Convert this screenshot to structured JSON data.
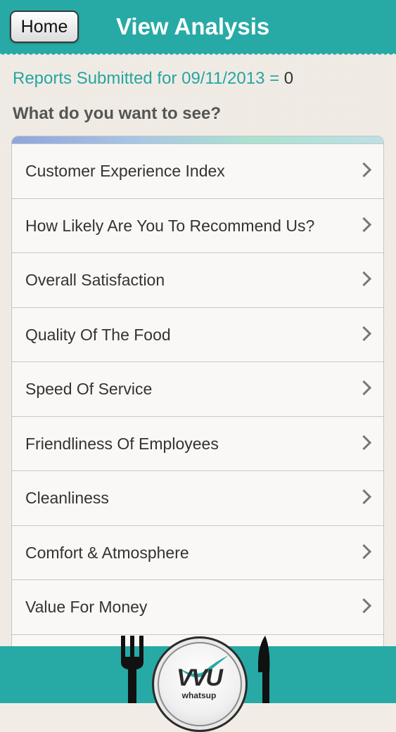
{
  "header": {
    "home_label": "Home",
    "title": "View Analysis",
    "color": "#27aaa5"
  },
  "reports": {
    "label": "Reports Submitted for 09/11/2013 = ",
    "count": "0"
  },
  "prompt": "What do you want to see?",
  "menu": {
    "items": [
      {
        "label": "Customer Experience Index"
      },
      {
        "label": "How Likely Are You To Recommend Us?"
      },
      {
        "label": "Overall Satisfaction"
      },
      {
        "label": "Quality Of The Food"
      },
      {
        "label": "Speed Of Service"
      },
      {
        "label": "Friendliness Of Employees"
      },
      {
        "label": "Cleanliness"
      },
      {
        "label": "Comfort & Atmosphere"
      },
      {
        "label": "Value For Money"
      },
      {
        "label": ""
      }
    ],
    "chevron_icon": "chevron-right-icon"
  },
  "footer": {
    "logo_text": "VVU",
    "logo_subtext": "whatsup",
    "icons": [
      "fork-icon",
      "knife-icon"
    ]
  }
}
